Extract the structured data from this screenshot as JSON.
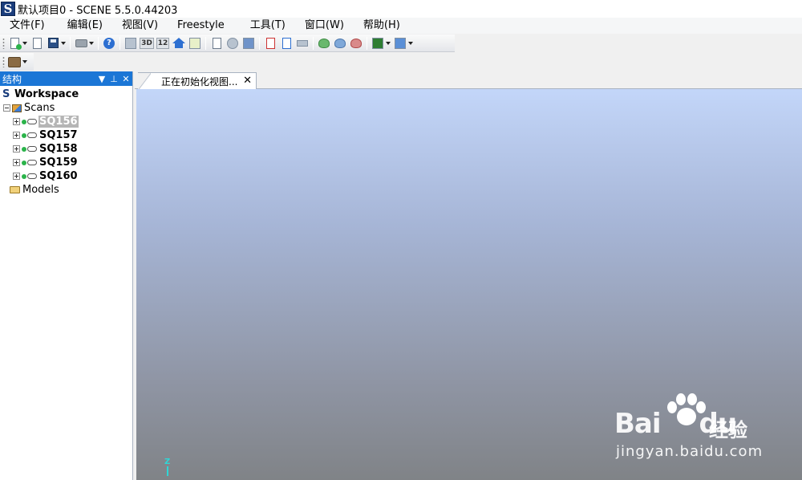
{
  "window": {
    "title": "默认项目0 - SCENE 5.5.0.44203",
    "app_icon_letter": "S"
  },
  "menu": [
    "文件(F)",
    "编辑(E)",
    "视图(V)",
    "Freestyle",
    "工具(T)",
    "窗口(W)",
    "帮助(H)"
  ],
  "toolbar": {
    "icons": [
      "new-project-icon",
      "open-icon",
      "save-icon",
      "print-icon",
      "help-icon",
      "scan-icon",
      "view-3d-icon",
      "view-2d-icon",
      "home-icon",
      "snapshot-icon",
      "copy-icon",
      "register-icon",
      "import-icon",
      "calendar-icon",
      "export-icon",
      "filter-icon",
      "cloud-add-icon",
      "cloud-upload-icon",
      "cloud-remove-icon",
      "camera-icon",
      "zoom-icon",
      "layer-icon"
    ],
    "label_3d": "3D",
    "label_12": "12"
  },
  "structure_panel": {
    "title": "结构",
    "workspace": {
      "icon_letter": "S",
      "label": "Workspace"
    },
    "scans_label": "Scans",
    "scans": [
      {
        "label": "SQ156",
        "selected": true
      },
      {
        "label": "SQ157",
        "selected": false
      },
      {
        "label": "SQ158",
        "selected": false
      },
      {
        "label": "SQ159",
        "selected": false
      },
      {
        "label": "SQ160",
        "selected": false
      }
    ],
    "models_label": "Models"
  },
  "document": {
    "tab_label": "正在初始化视图...",
    "close_glyph": "✕"
  },
  "viewport": {
    "axis_label": "Z",
    "gradient_top": "#c3d6f9",
    "gradient_bottom": "#808387"
  },
  "watermark": {
    "brand": "Bai",
    "brand_suffix": "du",
    "cn": "经验",
    "url": "jingyan.baidu.com"
  },
  "colors": {
    "panel_header": "#1b76d6",
    "selection": "#b5b5b5",
    "status_green": "#2bb34a"
  }
}
